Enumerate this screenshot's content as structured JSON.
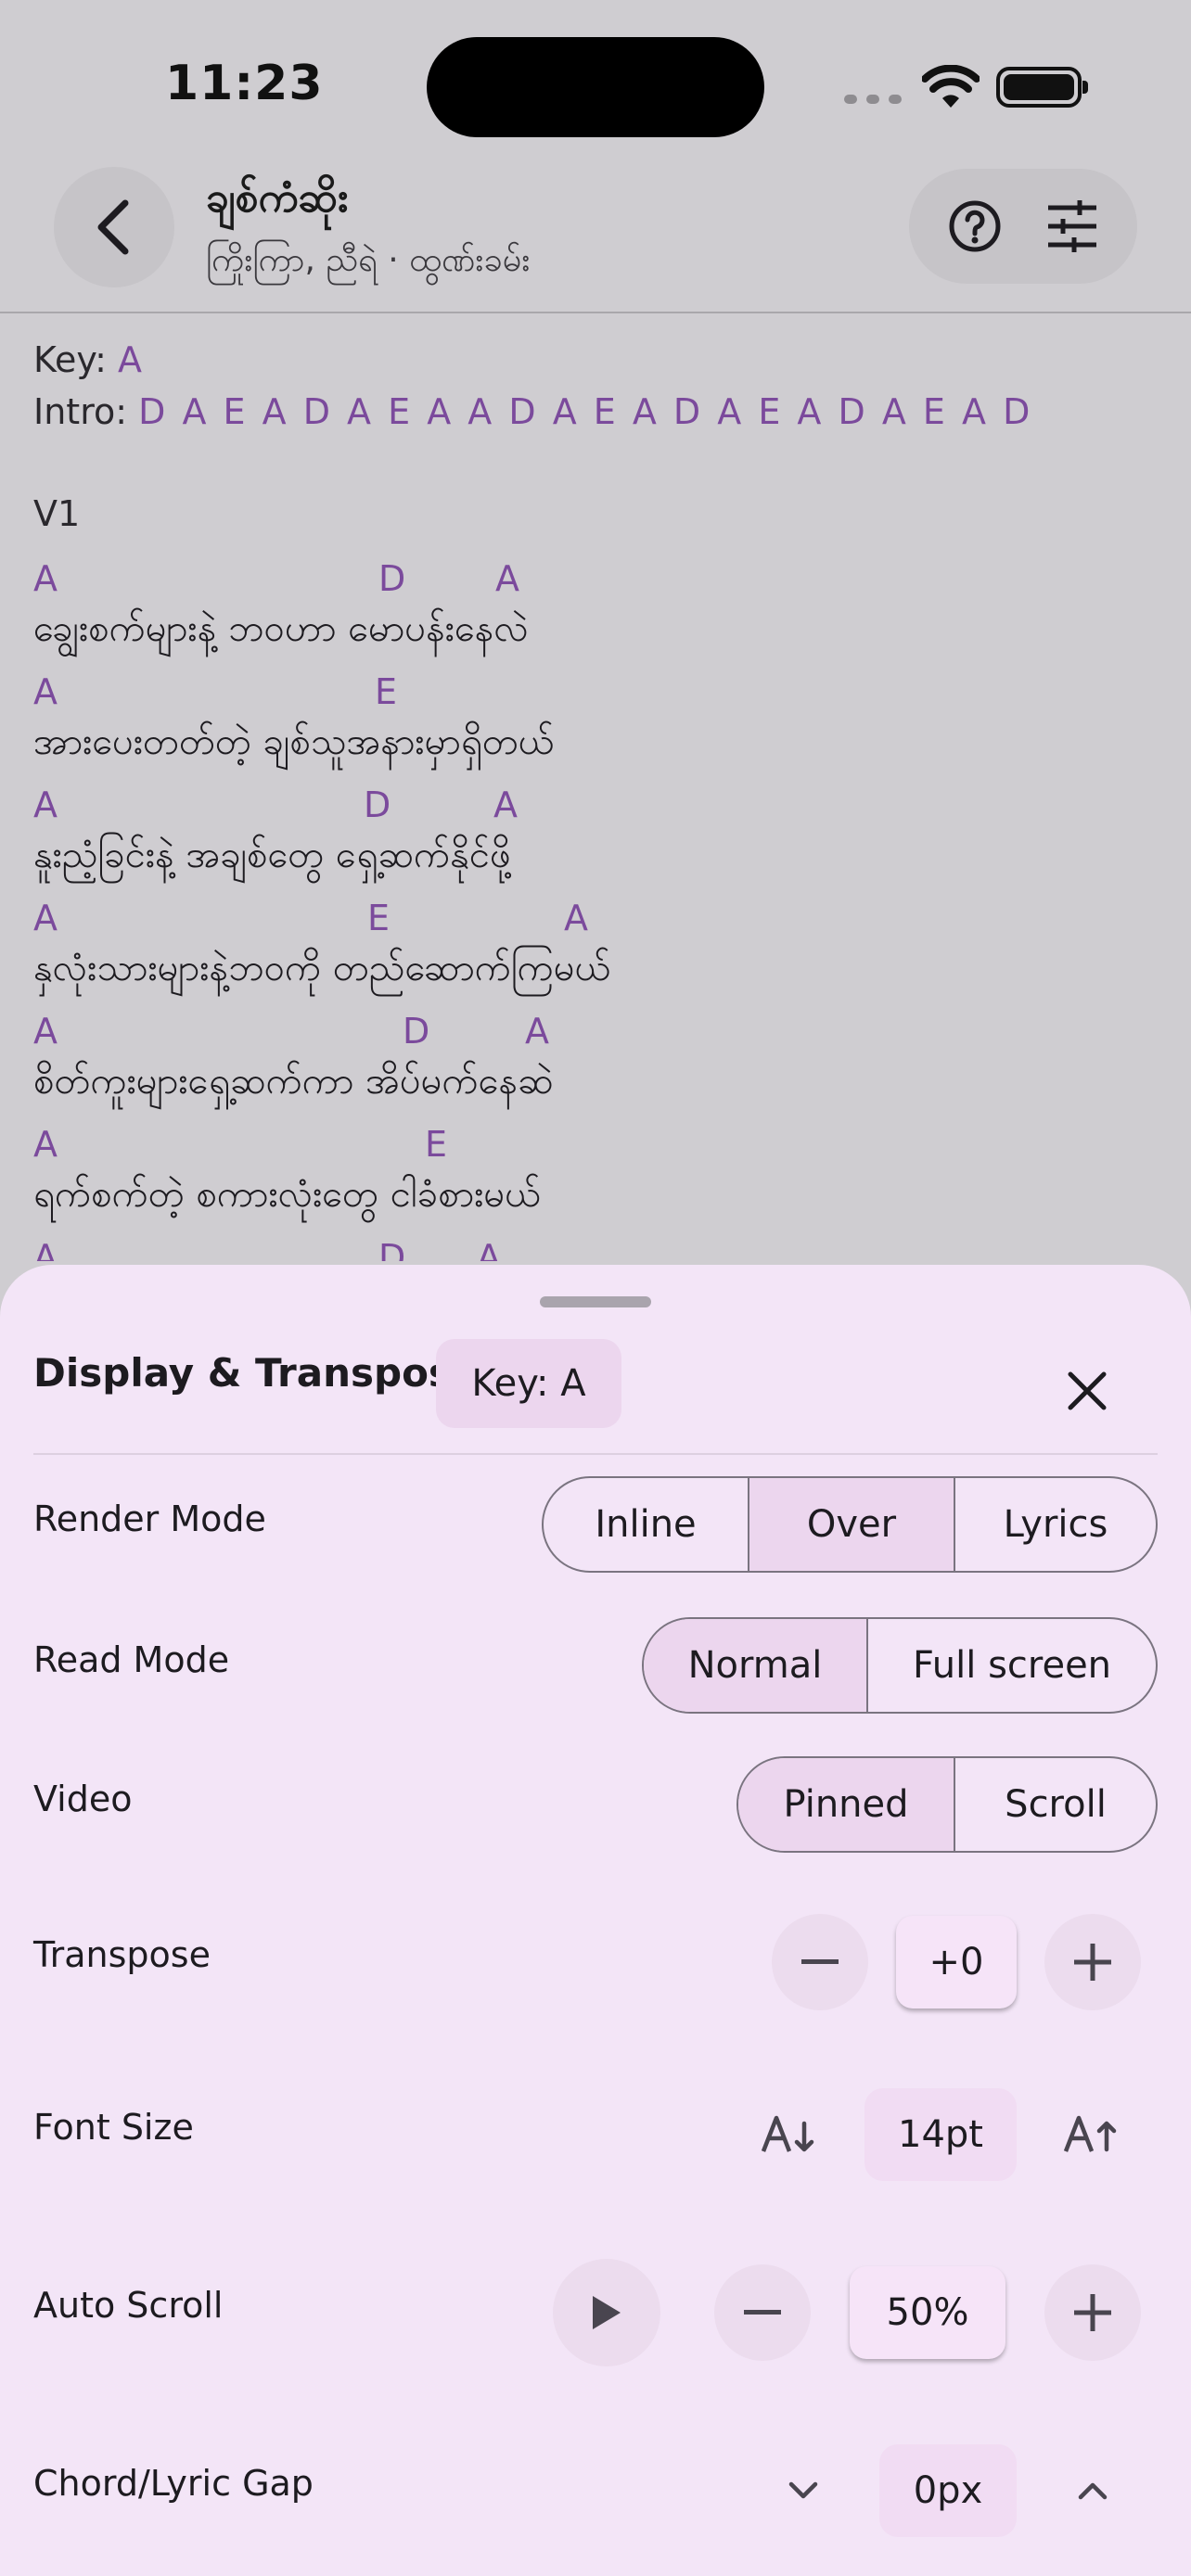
{
  "status_bar": {
    "time": "11:23"
  },
  "header": {
    "title": "ချစ်ကံဆိုး",
    "subtitle": "ကြိုးကြာ, ညီရဲ · ထွဏ်းခမ်း"
  },
  "sheet": {
    "key_label": "Key:",
    "key_value": "A",
    "intro_label": "Intro:",
    "intro_chords": "D A E A D A E A A D A E A D A E A D A E A D",
    "section": "V1",
    "lines": [
      {
        "chords": [
          "A",
          "D",
          "A"
        ],
        "lyric": "ချွေးစက်များနဲ့ ဘဝဟာ မောပန်းနေလဲ"
      },
      {
        "chords": [
          "A",
          "E"
        ],
        "lyric": "အားပေးတတ်တဲ့ ချစ်သူအနားမှာရှိတယ်"
      },
      {
        "chords": [
          "A",
          "D",
          "A"
        ],
        "lyric": "နူးညံ့ခြင်းနဲ့ အချစ်တွေ ရှေ့ဆက်နိုင်ဖို့"
      },
      {
        "chords": [
          "A",
          "E",
          "A"
        ],
        "lyric": "နှလုံးသားများနဲ့ဘဝကို တည်ဆောက်ကြမယ်"
      },
      {
        "chords": [
          "A",
          "D",
          "A"
        ],
        "lyric": "စိတ်ကူးများရှေ့ဆက်ကာ အိပ်မက်နေဆဲ"
      },
      {
        "chords": [
          "A",
          "E"
        ],
        "lyric": "ရက်စက်တဲ့ စကားလုံးတွေ ငါခံစားမယ်"
      },
      {
        "chords": [
          "A",
          "D",
          "A"
        ],
        "lyric": ""
      }
    ]
  },
  "panel": {
    "title": "Display & Transpose",
    "key_badge": "Key: A",
    "render_mode": {
      "label": "Render Mode",
      "options": [
        "Inline",
        "Over",
        "Lyrics"
      ],
      "selected": "Over"
    },
    "read_mode": {
      "label": "Read Mode",
      "options": [
        "Normal",
        "Full screen"
      ],
      "selected": "Normal"
    },
    "video": {
      "label": "Video",
      "options": [
        "Pinned",
        "Scroll"
      ],
      "selected": "Pinned"
    },
    "transpose": {
      "label": "Transpose",
      "value": "+0"
    },
    "font_size": {
      "label": "Font Size",
      "value": "14pt"
    },
    "auto_scroll": {
      "label": "Auto Scroll",
      "value": "50%"
    },
    "gap": {
      "label": "Chord/Lyric Gap",
      "value": "0px"
    }
  },
  "colors": {
    "chord": "#7b4a9c",
    "sheet_bg": "#f3e5f7",
    "active_segment": "#ecd6ee"
  },
  "icons": [
    "back-arrow-icon",
    "help-icon",
    "tune-icon",
    "close-icon",
    "minus-icon",
    "plus-icon",
    "font-decrease-icon",
    "font-increase-icon",
    "play-icon",
    "chevron-down-icon",
    "chevron-up-icon"
  ]
}
